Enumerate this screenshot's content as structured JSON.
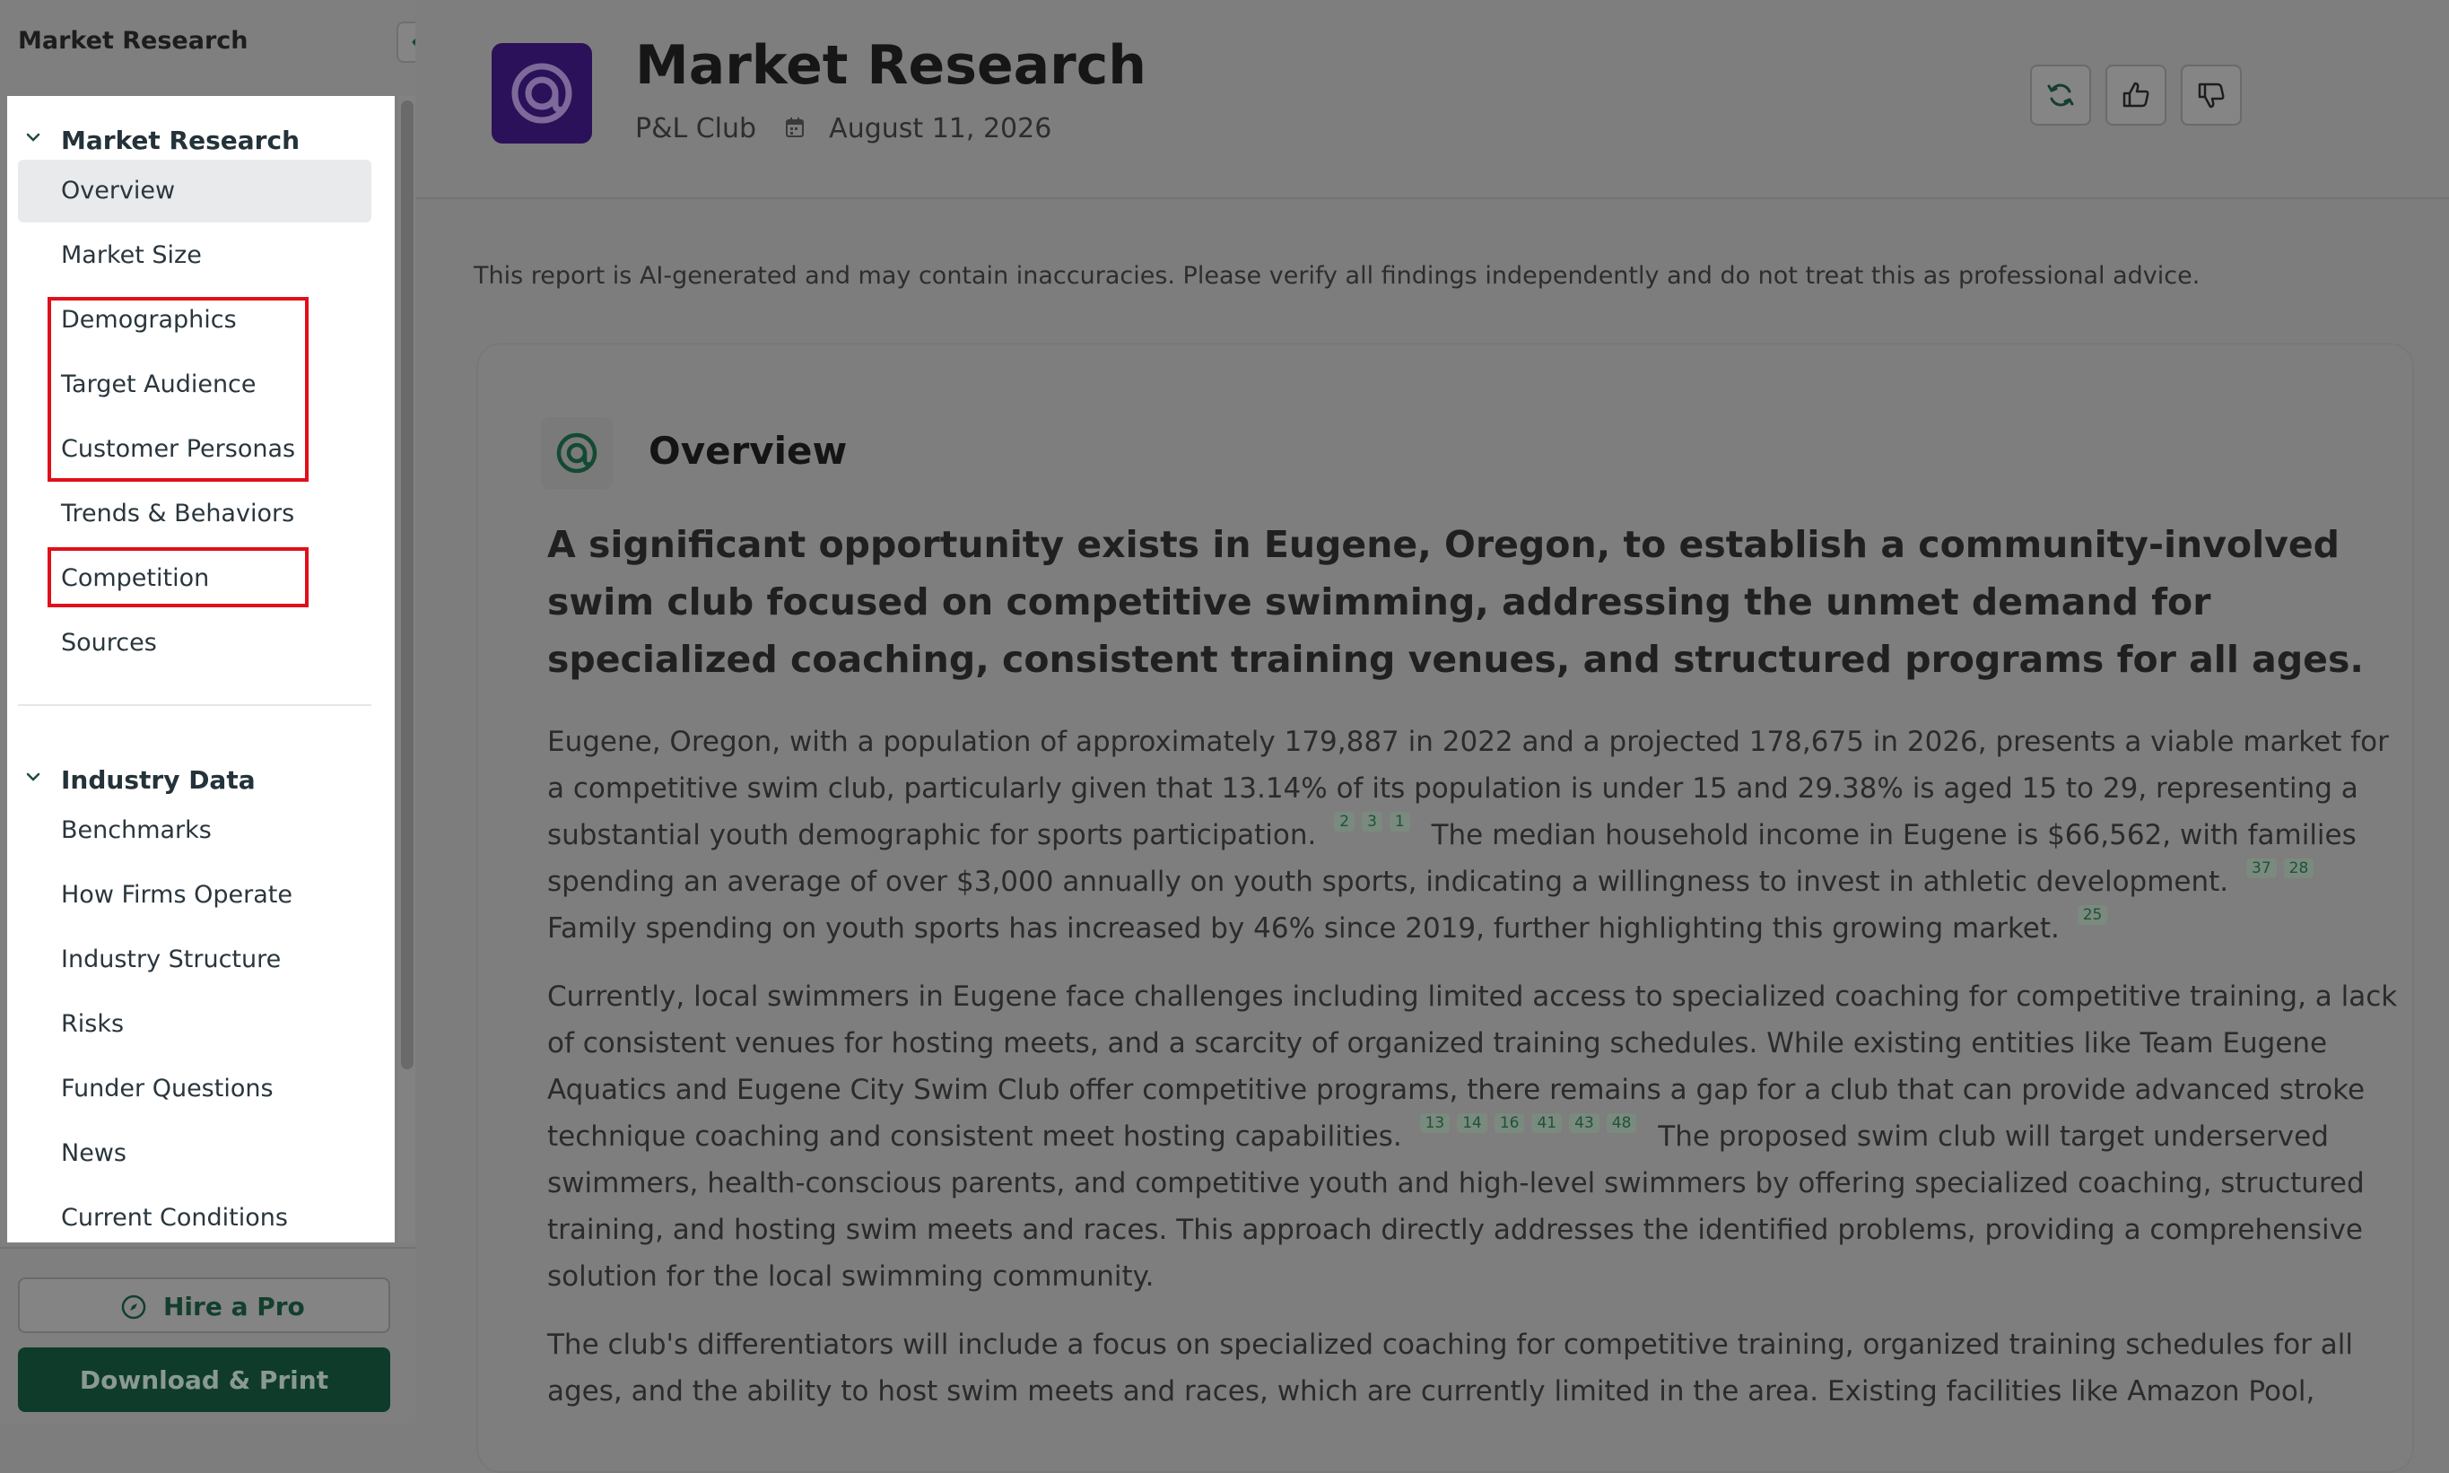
{
  "sidebar": {
    "title": "Market Research",
    "groups": [
      {
        "label": "Market Research",
        "items": [
          "Overview",
          "Market Size",
          "Demographics",
          "Target Audience",
          "Customer Personas",
          "Trends & Behaviors",
          "Competition",
          "Sources"
        ]
      },
      {
        "label": "Industry Data",
        "items": [
          "Benchmarks",
          "How Firms Operate",
          "Industry Structure",
          "Risks",
          "Funder Questions",
          "News",
          "Current Conditions"
        ]
      }
    ],
    "active_item": "Overview",
    "hire_label": "Hire a Pro",
    "download_label": "Download & Print"
  },
  "header": {
    "title": "Market Research",
    "club": "P&L Club",
    "date": "August 11, 2026"
  },
  "disclaimer": "This report is AI-generated and may contain inaccuracies. Please verify all findings independently and do not treat this as professional advice.",
  "overview": {
    "title": "Overview",
    "lead": "A significant opportunity exists in Eugene, Oregon, to establish a community-involved swim club focused on competitive swimming, addressing the unmet demand for specialized coaching, consistent training venues, and structured programs for all ages.",
    "p1": {
      "s1": "Eugene, Oregon, with a population of approximately 179,887 in 2022 and a projected 178,675 in 2026, presents a viable market for a competitive swim club, particularly given that 13.14% of its population is under 15 and 29.38% is aged 15 to 29, representing a substantial youth demographic for sports participation.",
      "c1": [
        "2",
        "3",
        "1"
      ],
      "s2": "The median household income in Eugene is $66,562, with families spending an average of over $3,000 annually on youth sports, indicating a willingness to invest in athletic development.",
      "c2": [
        "37",
        "28"
      ],
      "s3": "Family spending on youth sports has increased by 46% since 2019, further highlighting this growing market.",
      "c3": [
        "25"
      ]
    },
    "p2": {
      "s1": "Currently, local swimmers in Eugene face challenges including limited access to specialized coaching for competitive training, a lack of consistent venues for hosting meets, and a scarcity of organized training schedules. While existing entities like Team Eugene Aquatics and Eugene City Swim Club offer competitive programs, there remains a gap for a club that can provide advanced stroke technique coaching and consistent meet hosting capabilities.",
      "c1": [
        "13",
        "14",
        "16",
        "41",
        "43",
        "48"
      ],
      "s2": "The proposed swim club will target underserved swimmers, health-conscious parents, and competitive youth and high-level swimmers by offering specialized coaching, structured training, and hosting swim meets and races. This approach directly addresses the identified problems, providing a comprehensive solution for the local swimming community."
    },
    "p3": "The club's differentiators will include a focus on specialized coaching for competitive training, organized training schedules for all ages, and the ability to host swim meets and races, which are currently limited in the area. Existing facilities like Amazon Pool,"
  },
  "icons": {
    "collapse": "chevron-left-icon",
    "group_toggle": "chevron-down-icon",
    "hire": "compass-icon",
    "calendar": "calendar-icon",
    "regenerate": "refresh-icon",
    "like": "thumbs-up-icon",
    "dislike": "thumbs-down-icon",
    "logo": "target-at-icon"
  },
  "colors": {
    "brand_green": "#0f3b2a",
    "logo_purple": "#2b1159",
    "highlight_red": "#e0101a"
  }
}
